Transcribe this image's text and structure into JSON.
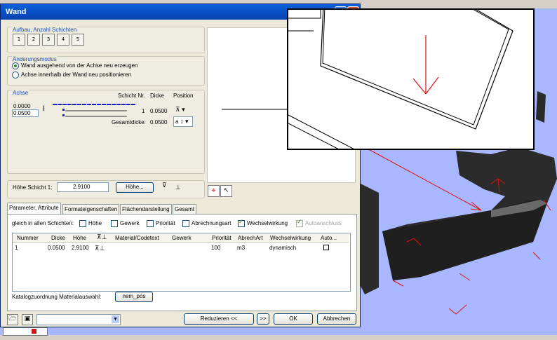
{
  "dialog": {
    "title": "Wand",
    "help_button": "?",
    "close_button": "X"
  },
  "aufbau": {
    "label": "Aufbau, Anzahl Schichten",
    "buttons": [
      "1",
      "2",
      "3",
      "4",
      "5"
    ]
  },
  "aenderung": {
    "label": "Änderungsmodus",
    "options": [
      "Wand ausgehend von der Achse neu erzeugen",
      "Achse innerhalb der Wand neu positionieren"
    ],
    "selected": 0
  },
  "achse": {
    "label": "Achse",
    "value1": "0.0000",
    "value2": "0.0500",
    "col_schicht": "Schicht Nr.",
    "col_dicke": "Dicke",
    "col_position": "Position",
    "row_nr": "1",
    "row_dicke": "0.0500",
    "gesamt_label": "Gesamtdicke:",
    "gesamt_value": "0.0500",
    "pos_dropdown": "a"
  },
  "hoehe": {
    "label": "Höhe Schicht 1:",
    "value": "2.9100",
    "button": "Höhe..."
  },
  "tabs": [
    "Parameter, Attribute",
    "Formateigenschaften",
    "Flächendarstellung",
    "Gesamt"
  ],
  "gleich": {
    "label": "gleich in allen Schichten:",
    "checks": [
      {
        "label": "Höhe",
        "checked": false
      },
      {
        "label": "Gewerk",
        "checked": false
      },
      {
        "label": "Priorität",
        "checked": false
      },
      {
        "label": "Abrechnungsart",
        "checked": false
      },
      {
        "label": "Wechselwirkung",
        "checked": true
      },
      {
        "label": "Autoanschluss",
        "checked": true
      }
    ]
  },
  "table": {
    "headers": [
      "Nummer",
      "Dicke",
      "Höhe",
      "",
      "Material/Codetext",
      "Gewerk",
      "Priorität",
      "AbrechArt",
      "Wechselwirkung",
      "Auto..."
    ],
    "row": [
      "1",
      "0.0500",
      "2.9100",
      "",
      "",
      "",
      "100",
      "m3",
      "dynamisch",
      ""
    ]
  },
  "katalog": {
    "label": "Katalogzuordnung Materialauswahl:",
    "button": "nem_pos"
  },
  "footer": {
    "reduzieren": "Reduzieren <<",
    "forward": ">>",
    "ok": "OK",
    "abbrechen": "Abbrechen"
  },
  "colors": {
    "title_bar": "#0a5fd8",
    "scene_bg": "#a9b7ff",
    "wall": "#2b2b2b",
    "annotation": "#e01010"
  }
}
